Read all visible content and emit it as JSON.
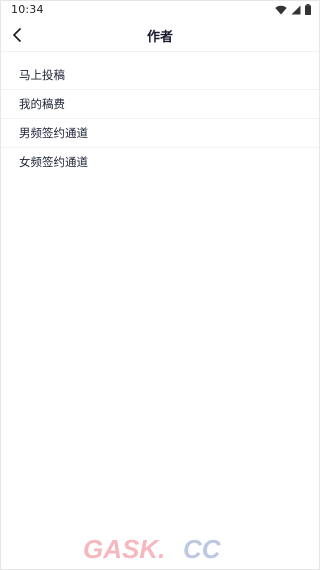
{
  "status_bar": {
    "time": "10:34",
    "icons": [
      "wifi-icon",
      "signal-icon",
      "battery-icon"
    ]
  },
  "header": {
    "title": "作者",
    "back_icon": "chevron-left-icon"
  },
  "menu": {
    "items": [
      {
        "label": "马上投稿"
      },
      {
        "label": "我的稿费"
      },
      {
        "label": "男频签约通道"
      },
      {
        "label": "女频签约通道"
      }
    ]
  },
  "watermark": {
    "text": "GASK.CC",
    "colors": {
      "gask": "#f2a0a8",
      "cc": "#a8b4d8"
    }
  }
}
